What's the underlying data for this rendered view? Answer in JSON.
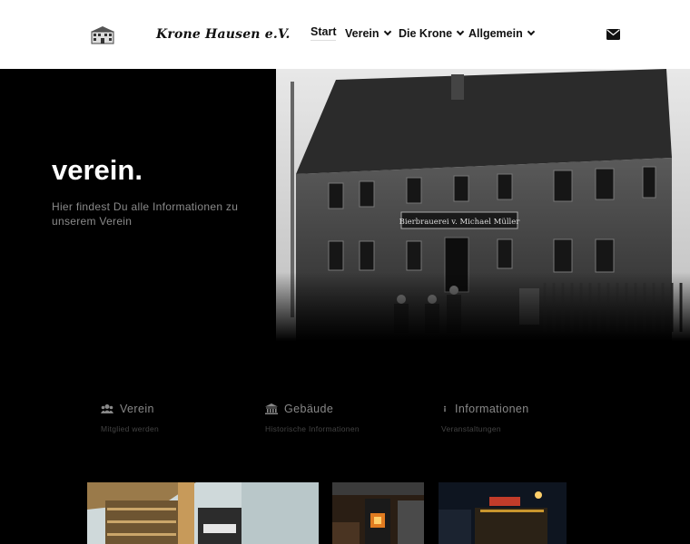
{
  "brand": {
    "logo_text": "Krone Hausen e.V."
  },
  "nav": {
    "items": [
      {
        "label": "Start"
      },
      {
        "label": "Verein"
      },
      {
        "label": "Die Krone"
      },
      {
        "label": "Allgemein"
      }
    ]
  },
  "hero": {
    "title": "verein.",
    "subtitle": "Hier findest Du alle Informationen zu unserem Verein",
    "photo_sign": "Bierbrauerei v. Michael Müller"
  },
  "features": [
    {
      "title": "Verein",
      "subtitle": "Mitglied werden",
      "icon": "users-icon"
    },
    {
      "title": "Gebäude",
      "subtitle": "Historische Informationen",
      "icon": "building-icon"
    },
    {
      "title": "Informationen",
      "subtitle": "Veranstaltungen",
      "icon": "info-icon"
    }
  ],
  "colors": {
    "background": "#000000",
    "header": "#ffffff",
    "muted_text": "#8a8a8a"
  }
}
